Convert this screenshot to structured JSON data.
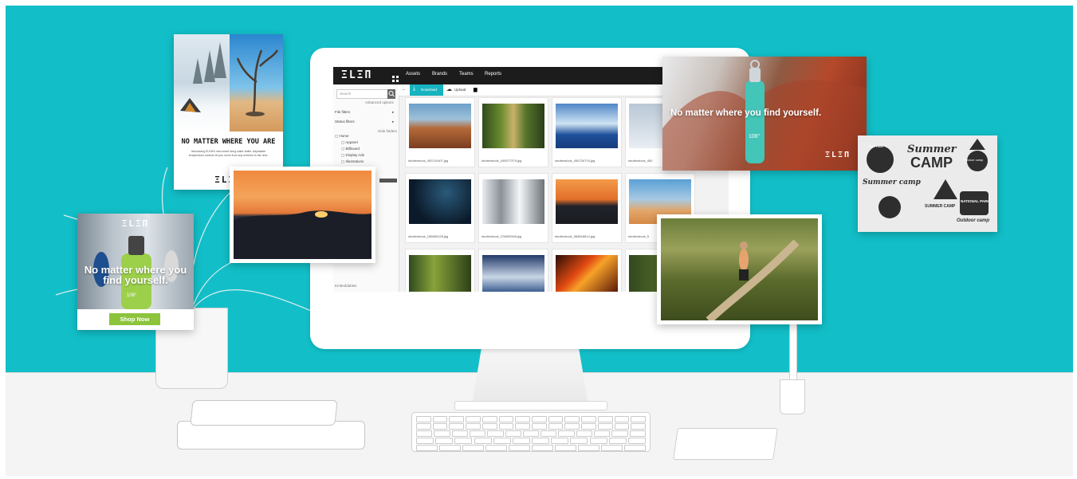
{
  "app": {
    "logo": "ΞLΞΠ",
    "nav_icon": "grid-icon",
    "nav": [
      "Assets",
      "Brands",
      "Teams",
      "Reports"
    ],
    "toolbar": {
      "download": "Download",
      "upload": "Upload"
    },
    "sidebar": {
      "search_placeholder": "Search",
      "advanced": "Advanced options",
      "file_filters": "File filters",
      "status_filters": "Status filters",
      "hide_folders": "Hide folders",
      "folders": [
        "Home",
        "Apparel",
        "Billboard",
        "Display Ads",
        "Illustrations"
      ],
      "footer": "Embeddables"
    },
    "files": [
      "shutterstock_400741407.jpg",
      "shutterstock_445077379.jpg",
      "shutterstock_450734715.jpg",
      "shutterstock_450",
      "shutterstock_156683128.jpg",
      "shutterstock_378893348.jpg",
      "shutterstock_368818614.jpg",
      "shutterstock_5"
    ]
  },
  "cards": {
    "poster_headline": "NO MATTER WHERE YOU ARE",
    "poster_body": "Introducing ELEM's new smart living water bottle. Adjustable temperature controls let you move from any extreme to the next.",
    "poster_logo": "ΞLΞΠ",
    "banner_headline": "No matter where you find yourself.",
    "banner_logo": "ΞLΞΠ",
    "ad_logo": "ΞLΞΠ",
    "ad_headline": "No matter where you find yourself.",
    "ad_button": "Shop Now",
    "bottle_temp": "106°",
    "camp_title_1": "Summer",
    "camp_title_2": "CAMP",
    "camp_small": [
      "RAFTING",
      "Summer camp",
      "Outdoor camp",
      "NATIONAL PARK",
      "SUMMER CAMP",
      "Outdoor camp"
    ]
  },
  "colors": {
    "teal": "#12bfc8",
    "accent": "#16b3c0",
    "shop_green": "#8cc43c"
  }
}
